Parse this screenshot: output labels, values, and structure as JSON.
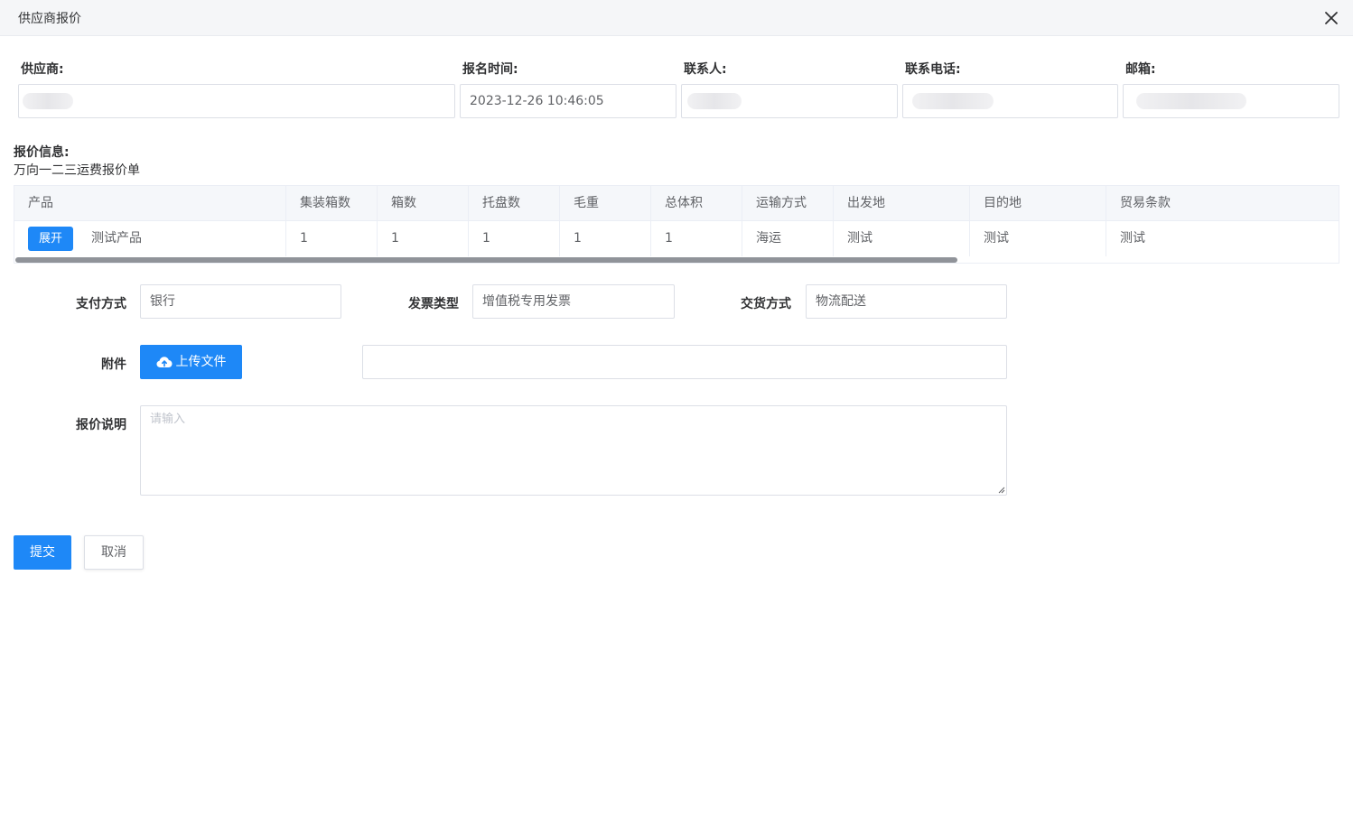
{
  "dialog": {
    "title": "供应商报价",
    "close_icon": "close-icon"
  },
  "info": {
    "supplier_label": "供应商:",
    "supplier_value": "",
    "signup_time_label": "报名时间:",
    "signup_time_value": "2023-12-26 10:46:05",
    "contact_label": "联系人:",
    "contact_value": "",
    "phone_label": "联系电话:",
    "phone_value": "",
    "email_label": "邮箱:",
    "email_value": ""
  },
  "quote": {
    "section_title": "报价信息:",
    "sheet_name": "万向一二三运费报价单"
  },
  "table": {
    "headers": [
      "产品",
      "集装箱数",
      "箱数",
      "托盘数",
      "毛重",
      "总体积",
      "运输方式",
      "出发地",
      "目的地",
      "贸易条款"
    ],
    "expand_label": "展开",
    "row": {
      "product": "测试产品",
      "containers": "1",
      "boxes": "1",
      "pallets": "1",
      "gross_weight": "1",
      "total_volume": "1",
      "transport": "海运",
      "origin": "测试",
      "destination": "测试",
      "trade_terms": "测试"
    }
  },
  "form": {
    "payment_label": "支付方式",
    "payment_value": "银行",
    "invoice_label": "发票类型",
    "invoice_value": "增值税专用发票",
    "delivery_label": "交货方式",
    "delivery_value": "物流配送",
    "attachment_label": "附件",
    "upload_label": "上传文件",
    "upload_icon": "cloud-upload-icon",
    "attachment_value": "",
    "remark_label": "报价说明",
    "remark_placeholder": "请输入"
  },
  "actions": {
    "submit_label": "提交",
    "cancel_label": "取消"
  },
  "colors": {
    "primary": "#1e88f7",
    "border": "#dcdfe6",
    "header_bg": "#f5f6f8"
  }
}
